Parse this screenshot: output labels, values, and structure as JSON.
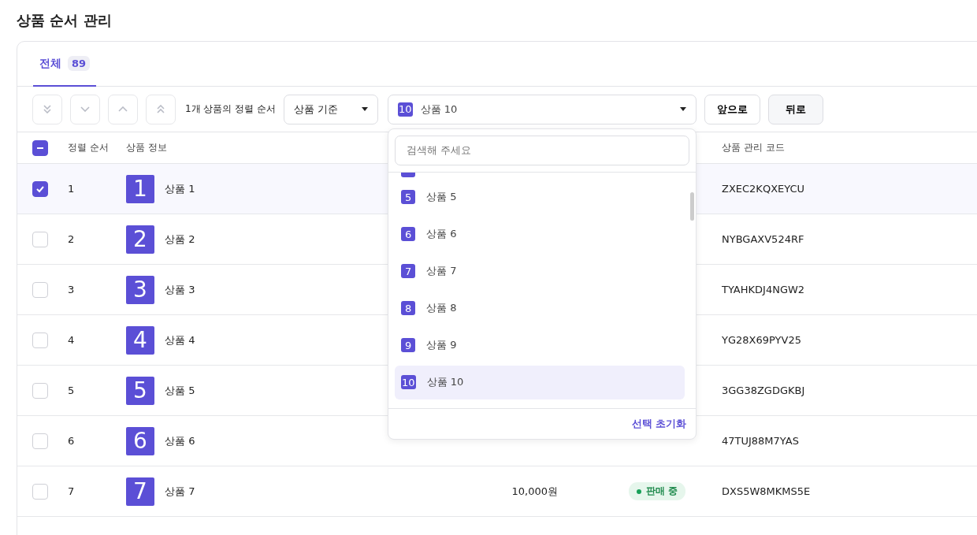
{
  "page_title": "상품 순서 관리",
  "tabs": [
    {
      "label": "전체",
      "count": "89",
      "selected": true
    }
  ],
  "toolbar": {
    "move_buttons": [
      {
        "kind": "bottom"
      },
      {
        "kind": "down"
      },
      {
        "kind": "up"
      },
      {
        "kind": "top"
      }
    ],
    "sort_label": "1개 상품의 정렬 순서",
    "basis_select": {
      "value": "상품 기준"
    },
    "product_select": {
      "number": "10",
      "value": "상품 10",
      "expanded": true
    },
    "buttons": [
      {
        "label": "앞으로",
        "hovered": false
      },
      {
        "label": "뒤로",
        "hovered": true
      }
    ]
  },
  "dropdown": {
    "search_placeholder": "검색해 주세요",
    "options": [
      {
        "number": "5",
        "label": "상품 5",
        "selected": false
      },
      {
        "number": "6",
        "label": "상품 6",
        "selected": false
      },
      {
        "number": "7",
        "label": "상품 7",
        "selected": false
      },
      {
        "number": "8",
        "label": "상품 8",
        "selected": false
      },
      {
        "number": "9",
        "label": "상품 9",
        "selected": false
      },
      {
        "number": "10",
        "label": "상품 10",
        "selected": true
      }
    ],
    "reset_label": "선택 초기화"
  },
  "table": {
    "header_indeterminate": true,
    "columns": [
      "정렬 순서",
      "상품 정보",
      "상품 관리 코드"
    ],
    "rows": [
      {
        "checked": true,
        "order": "1",
        "thumb": "1",
        "name": "상품 1",
        "code": "ZXEC2KQXEYCU"
      },
      {
        "checked": false,
        "order": "2",
        "thumb": "2",
        "name": "상품 2",
        "code": "NYBGAXV524RF"
      },
      {
        "checked": false,
        "order": "3",
        "thumb": "3",
        "name": "상품 3",
        "code": "TYAHKDJ4NGW2"
      },
      {
        "checked": false,
        "order": "4",
        "thumb": "4",
        "name": "상품 4",
        "code": "YG28X69PYV25"
      },
      {
        "checked": false,
        "order": "5",
        "thumb": "5",
        "name": "상품 5",
        "code": "3GG38ZGDGKBJ"
      },
      {
        "checked": false,
        "order": "6",
        "thumb": "6",
        "name": "상품 6",
        "code": "47TUJ88M7YAS"
      },
      {
        "checked": false,
        "order": "7",
        "thumb": "7",
        "name": "상품 7",
        "price": "10,000원",
        "status": "판매 중",
        "code": "DXS5W8MKMS5E"
      }
    ]
  }
}
